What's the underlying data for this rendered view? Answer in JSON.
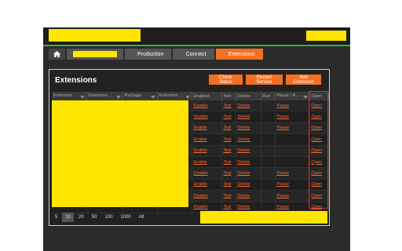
{
  "breadcrumbs": [
    "Production",
    "Connect",
    "Extensions"
  ],
  "panel": {
    "title": "Extensions",
    "buttons": {
      "check_status": "Check Status",
      "restart_service": "Restart Service",
      "add_extension": "Add Extension"
    }
  },
  "table": {
    "headers": [
      "Extension",
      "Extension ...",
      "Package",
      "Extension ...",
      "Enabled",
      "Test",
      "Delete",
      "Run",
      "Pause / R...",
      "Open"
    ],
    "rows": [
      {
        "enabled": "Disable",
        "test": "Test",
        "delete": "Delete",
        "pause": "Pause",
        "open": "Open"
      },
      {
        "enabled": "Disable",
        "test": "Test",
        "delete": "Delete",
        "pause": "Pause",
        "open": "Open"
      },
      {
        "enabled": "Enable",
        "test": "Test",
        "delete": "Delete",
        "pause": "Pause",
        "open": "Open"
      },
      {
        "enabled": "Enable",
        "test": "Test",
        "delete": "Delete",
        "pause": "",
        "open": "Open"
      },
      {
        "enabled": "Enable",
        "test": "Test",
        "delete": "Delete",
        "pause": "",
        "open": "Open"
      },
      {
        "enabled": "Enable",
        "test": "Test",
        "delete": "Delete",
        "pause": "",
        "open": "Open"
      },
      {
        "enabled": "Disable",
        "test": "Test",
        "delete": "Delete",
        "pause": "Pause",
        "open": "Open"
      },
      {
        "enabled": "Enable",
        "test": "Test",
        "delete": "Delete",
        "pause": "Pause",
        "open": "Open"
      },
      {
        "enabled": "Disable",
        "test": "Test",
        "delete": "Delete",
        "pause": "Pause",
        "open": "Open"
      },
      {
        "enabled": "Disable",
        "test": "Test",
        "delete": "Delete",
        "pause": "Pause",
        "open": "Open"
      }
    ]
  },
  "pagination": [
    "5",
    "10",
    "20",
    "50",
    "100",
    "1000",
    "All"
  ],
  "pagination_selected": "10"
}
